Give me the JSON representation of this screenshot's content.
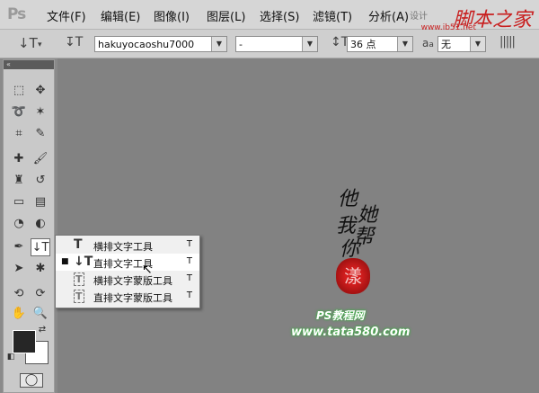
{
  "app": {
    "logo": "Ps"
  },
  "menu": [
    "文件(F)",
    "编辑(E)",
    "图像(I)",
    "图层(L)",
    "选择(S)",
    "滤镜(T)",
    "分析(A)"
  ],
  "watermark": {
    "title": "脚本之家",
    "url": "www.jb51.net",
    "extra": "设计"
  },
  "options": {
    "font_family": "hakuyocaoshu7000",
    "font_style": "-",
    "font_size": "36 点",
    "aa_label": "a",
    "aa_value": "无"
  },
  "tool_flyout": {
    "items": [
      {
        "icon": "T",
        "label": "横排文字工具",
        "shortcut": "T",
        "selected": false
      },
      {
        "icon": "↓T",
        "label": "直排文字工具",
        "shortcut": "T",
        "selected": true
      },
      {
        "icon": "T",
        "label": "横排文字蒙版工具",
        "shortcut": "T",
        "selected": false
      },
      {
        "icon": "T",
        "label": "直排文字蒙版工具",
        "shortcut": "T",
        "selected": false
      }
    ]
  },
  "artwork": {
    "calligraphy": [
      "他",
      "她",
      "帮",
      "我",
      "你"
    ],
    "seal": "漾",
    "credit_line1": "PS教程网",
    "credit_line2": "www.tata580.com"
  }
}
